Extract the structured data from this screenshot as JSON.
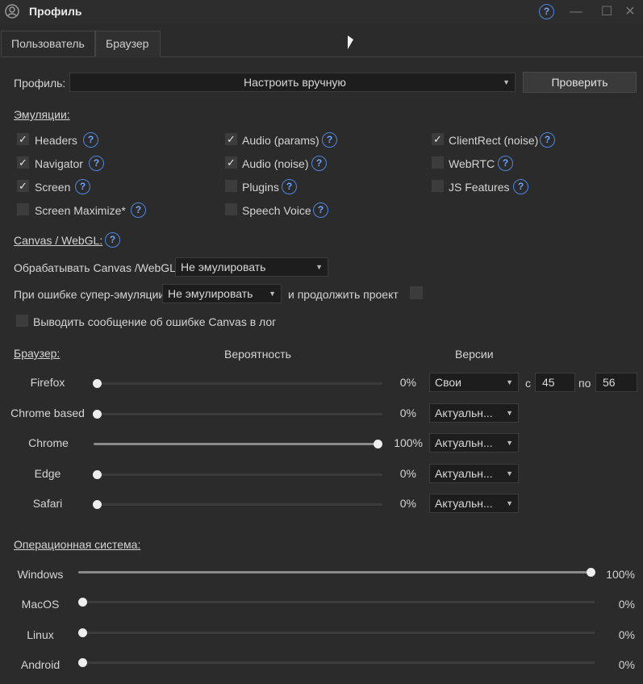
{
  "window": {
    "title": "Профиль"
  },
  "tabs": [
    {
      "label": "Пользователь"
    },
    {
      "label": "Браузер"
    }
  ],
  "profile": {
    "label": "Профиль:",
    "value": "Настроить вручную",
    "check_button": "Проверить"
  },
  "emulations": {
    "heading": "Эмуляции:",
    "items": [
      {
        "label": "Headers",
        "checked": true
      },
      {
        "label": "Navigator",
        "checked": true
      },
      {
        "label": "Screen",
        "checked": true
      },
      {
        "label": "Screen Maximize*",
        "checked": false
      },
      {
        "label": "Audio (params)",
        "checked": true
      },
      {
        "label": "Audio (noise)",
        "checked": true
      },
      {
        "label": "Plugins",
        "checked": false
      },
      {
        "label": "Speech Voice",
        "checked": false
      },
      {
        "label": "ClientRect (noise)",
        "checked": true
      },
      {
        "label": "WebRTC",
        "checked": false
      },
      {
        "label": "JS Features",
        "checked": false
      }
    ]
  },
  "canvas": {
    "heading": "Canvas / WebGL:",
    "process_label": "Обрабатывать Canvas /WebGL",
    "process_value": "Не эмулировать",
    "super_error_label": "При ошибке супер-эмуляции",
    "super_error_value": "Не эмулировать",
    "continue_label": "и продолжить проект",
    "continue_checked": false,
    "log_label": "Выводить сообщение об ошибке Canvas в лог",
    "log_checked": false
  },
  "browsers": {
    "heading": "Браузер:",
    "probability_header": "Вероятность",
    "versions_header": "Версии",
    "from_label": "с",
    "to_label": "по",
    "items": [
      {
        "name": "Firefox",
        "percent": "0%",
        "value": 0,
        "version_mode": "Свои",
        "from": "45",
        "to": "56"
      },
      {
        "name": "Chrome based",
        "percent": "0%",
        "value": 0,
        "version_mode": "Актуальн..."
      },
      {
        "name": "Chrome",
        "percent": "100%",
        "value": 100,
        "version_mode": "Актуальн..."
      },
      {
        "name": "Edge",
        "percent": "0%",
        "value": 0,
        "version_mode": "Актуальн..."
      },
      {
        "name": "Safari",
        "percent": "0%",
        "value": 0,
        "version_mode": "Актуальн..."
      }
    ]
  },
  "os": {
    "heading": "Операционная система:",
    "items": [
      {
        "name": "Windows",
        "percent": "100%",
        "value": 100
      },
      {
        "name": "MacOS",
        "percent": "0%",
        "value": 0
      },
      {
        "name": "Linux",
        "percent": "0%",
        "value": 0
      },
      {
        "name": "Android",
        "percent": "0%",
        "value": 0
      }
    ]
  },
  "icons": {
    "app": "user-circle-icon",
    "help": "question-icon",
    "minimize": "minimize-icon",
    "maximize": "maximize-icon",
    "close": "close-icon",
    "checkmark": "checkmark-icon",
    "dropdown": "chevron-down-icon"
  },
  "colors": {
    "background": "#2b2b2b",
    "accent": "#4e86e0"
  }
}
